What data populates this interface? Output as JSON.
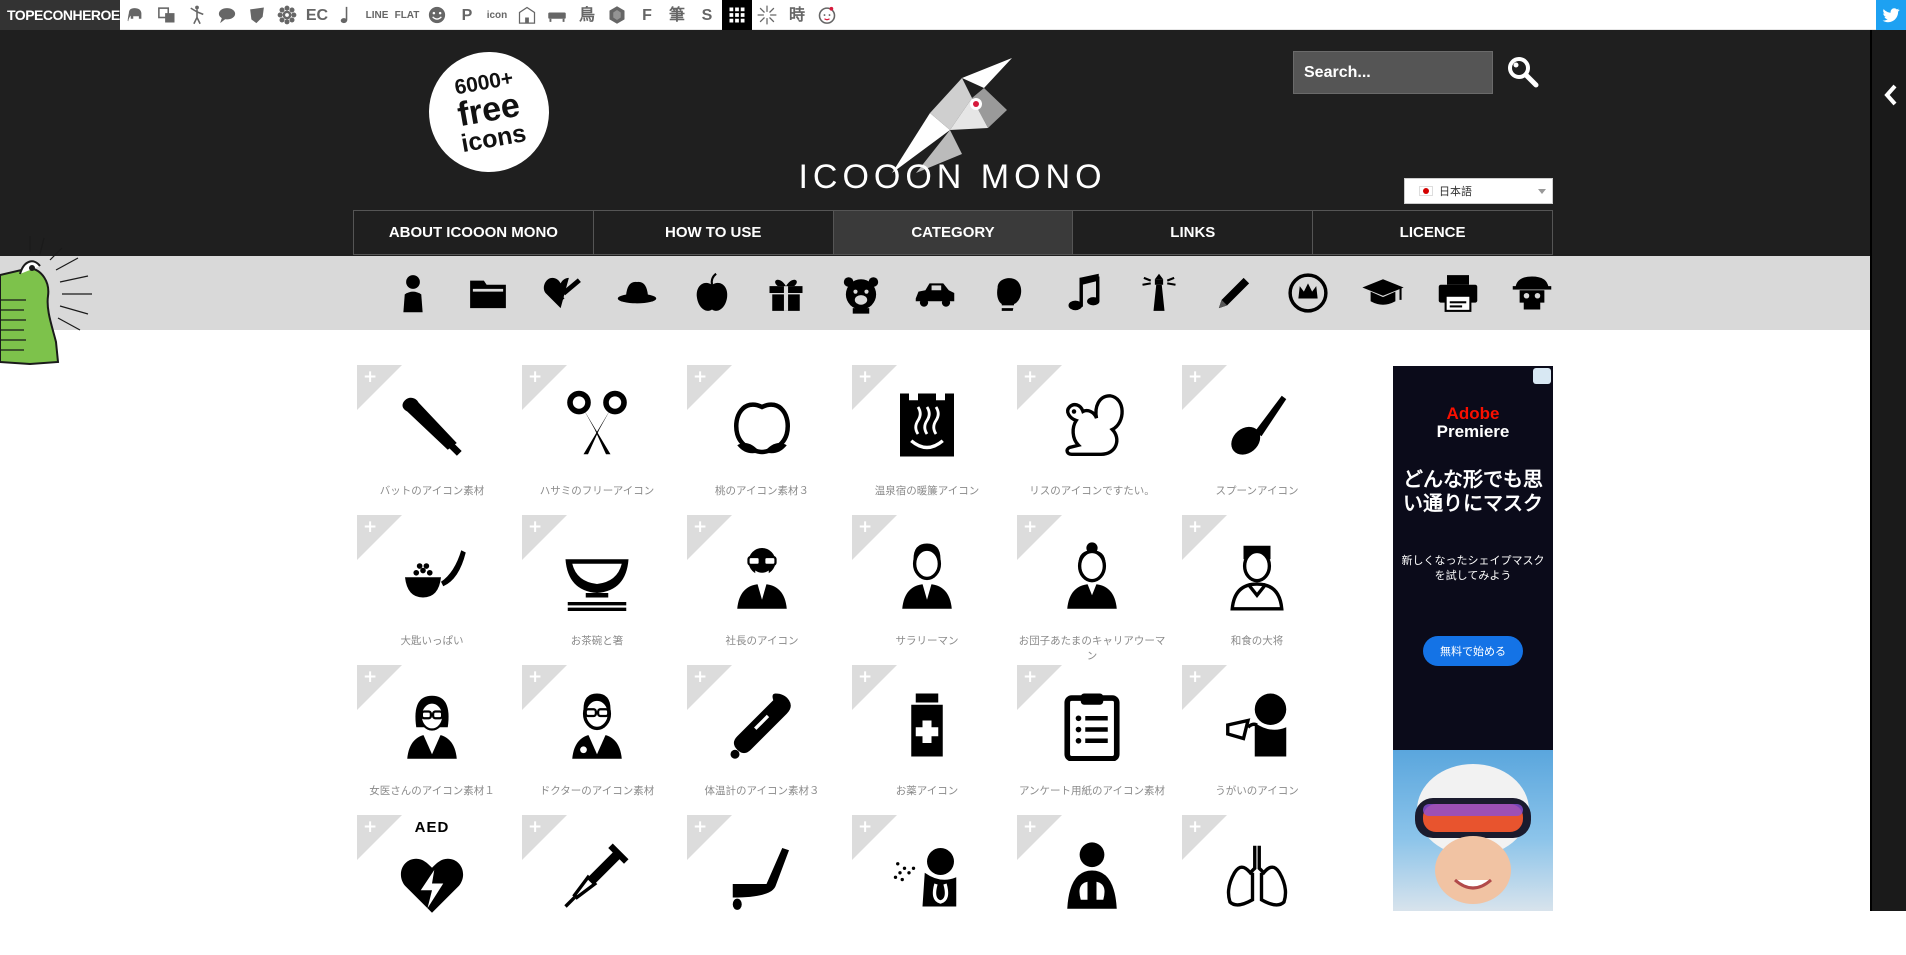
{
  "topbar": {
    "brand": "TOPECONHEROES",
    "sites": [
      {
        "name": "elephant-icon"
      },
      {
        "name": "layers-icon"
      },
      {
        "name": "yoga-figure-icon"
      },
      {
        "name": "speech-bubble-icon"
      },
      {
        "name": "ribbon-icon"
      },
      {
        "name": "gear-flower-icon"
      },
      {
        "name": "ec-icon",
        "text": "EC"
      },
      {
        "name": "music-note-icon"
      },
      {
        "name": "line-icon",
        "text": "LINE"
      },
      {
        "name": "flat-icon",
        "text": "FLAT"
      },
      {
        "name": "smile-icon"
      },
      {
        "name": "parking-icon",
        "text": "P"
      },
      {
        "name": "icon-text-icon",
        "text": "icon"
      },
      {
        "name": "building-icon"
      },
      {
        "name": "sofa-icon"
      },
      {
        "name": "bird-kanji-icon",
        "text": "鳥"
      },
      {
        "name": "hexagon-icon"
      },
      {
        "name": "f-icon",
        "text": "F"
      },
      {
        "name": "brush-kanji-icon",
        "text": "筆"
      },
      {
        "name": "s-icon",
        "text": "S"
      },
      {
        "name": "grid-icon"
      },
      {
        "name": "burst-icon"
      },
      {
        "name": "time-kanji-icon",
        "text": "時"
      },
      {
        "name": "face-icon"
      }
    ]
  },
  "header": {
    "badge": {
      "line1": "6000+",
      "line2": "free",
      "line3": "icons"
    },
    "title": "ICOOON MONO",
    "search_placeholder": "Search...",
    "language": "日本語"
  },
  "nav": [
    {
      "label": "ABOUT ICOOON MONO",
      "active": false
    },
    {
      "label": "HOW TO USE",
      "active": false
    },
    {
      "label": "CATEGORY",
      "active": true
    },
    {
      "label": "LINKS",
      "active": false
    },
    {
      "label": "LICENCE",
      "active": false
    }
  ],
  "categories": [
    "person-icon",
    "folder-icon",
    "heart-syringe-icon",
    "hat-icon",
    "apple-icon",
    "gift-icon",
    "bear-icon",
    "car-icon",
    "boxing-glove-icon",
    "music-note-icon",
    "lighthouse-icon",
    "pencil-icon",
    "crown-icon",
    "graduation-cap-icon",
    "printer-icon",
    "skull-icon"
  ],
  "icons": [
    {
      "caption": "バットのアイコン素材",
      "icon": "bat-icon"
    },
    {
      "caption": "ハサミのフリーアイコン",
      "icon": "scissors-icon"
    },
    {
      "caption": "桃のアイコン素材３",
      "icon": "peach-icon"
    },
    {
      "caption": "温泉宿の暖簾アイコン",
      "icon": "hot-spring-icon"
    },
    {
      "caption": "リスのアイコンですたい。",
      "icon": "squirrel-icon"
    },
    {
      "caption": "スプーンアイコン",
      "icon": "spoon-icon"
    },
    {
      "caption": "大匙いっぱい",
      "icon": "ladle-icon"
    },
    {
      "caption": "お茶碗と箸",
      "icon": "rice-bowl-icon"
    },
    {
      "caption": "社長のアイコン",
      "icon": "president-icon"
    },
    {
      "caption": "サラリーマン",
      "icon": "salaryman-icon"
    },
    {
      "caption": "お団子あたまのキャリアウーマン",
      "icon": "career-woman-icon"
    },
    {
      "caption": "和食の大将",
      "icon": "chef-icon"
    },
    {
      "caption": "女医さんのアイコン素材１",
      "icon": "female-doctor-icon"
    },
    {
      "caption": "ドクターのアイコン素材",
      "icon": "doctor-icon"
    },
    {
      "caption": "体温計のアイコン素材３",
      "icon": "thermometer-icon"
    },
    {
      "caption": "お薬アイコン",
      "icon": "medicine-bottle-icon"
    },
    {
      "caption": "アンケート用紙のアイコン素材",
      "icon": "clipboard-icon"
    },
    {
      "caption": "うがいのアイコン",
      "icon": "gargle-icon"
    },
    {
      "caption": "",
      "icon": "aed-icon",
      "label": "AED"
    },
    {
      "caption": "",
      "icon": "syringe-icon"
    },
    {
      "caption": "",
      "icon": "scalpel-icon"
    },
    {
      "caption": "",
      "icon": "spray-icon"
    },
    {
      "caption": "",
      "icon": "lungs-body-icon"
    },
    {
      "caption": "",
      "icon": "lungs-icon"
    }
  ],
  "tile_plus": "+",
  "ad": {
    "brand_line1": "Adobe",
    "brand_line2": "Premiere",
    "headline": "どんな形でも思い通りにマスク",
    "sub": "新しくなったシェイプマスクを試してみよう",
    "cta": "無料で始める"
  },
  "colors": {
    "header_bg": "#1f1f1f",
    "catbar_bg": "#d9d9d9",
    "twitter": "#1da1f2",
    "ad_cta": "#1473e6"
  }
}
